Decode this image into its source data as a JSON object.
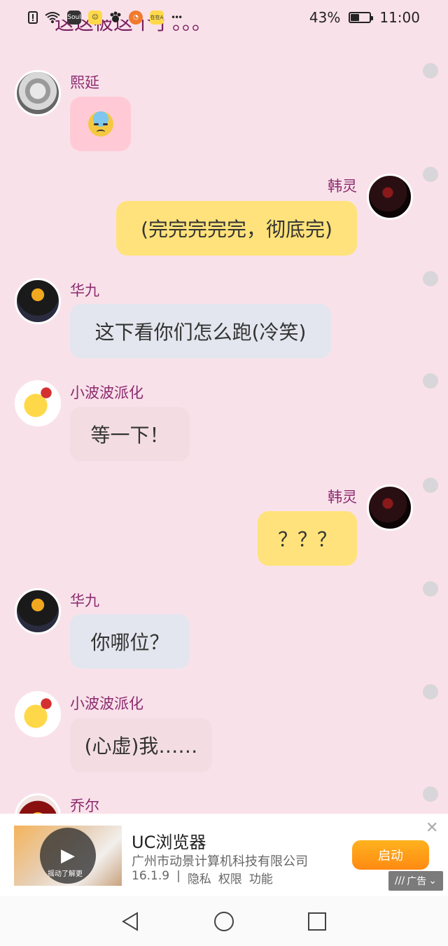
{
  "status": {
    "battery_percent": "43%",
    "battery_level": 0.43,
    "time": "11:00",
    "more": "•••",
    "app_icons": [
      "Soul",
      "在在A"
    ]
  },
  "chat": {
    "partial_top_text": "这这被这个了。。。",
    "messages": [
      {
        "sender": "熙延",
        "text": "",
        "emoji": "anxious-sweat-emoji"
      },
      {
        "sender": "韩灵",
        "text": "(完完完完完，彻底完)"
      },
      {
        "sender": "华九",
        "text": "这下看你们怎么跑(冷笑)"
      },
      {
        "sender": "小波波派化",
        "text": "等一下！"
      },
      {
        "sender": "韩灵",
        "text": "？？？"
      },
      {
        "sender": "华九",
        "text": "你哪位？"
      },
      {
        "sender": "小波波派化",
        "text": "(心虚)我……"
      },
      {
        "sender": "乔尔",
        "text": ""
      }
    ]
  },
  "ad": {
    "title": "UC浏览器",
    "company": "广州市动景计算机科技有限公司",
    "version": "16.1.9",
    "separator": "|",
    "privacy": "隐私",
    "permissions": "权限",
    "features": "功能",
    "button": "启动",
    "badge": "广告",
    "video_caption": "摇动了解更"
  }
}
